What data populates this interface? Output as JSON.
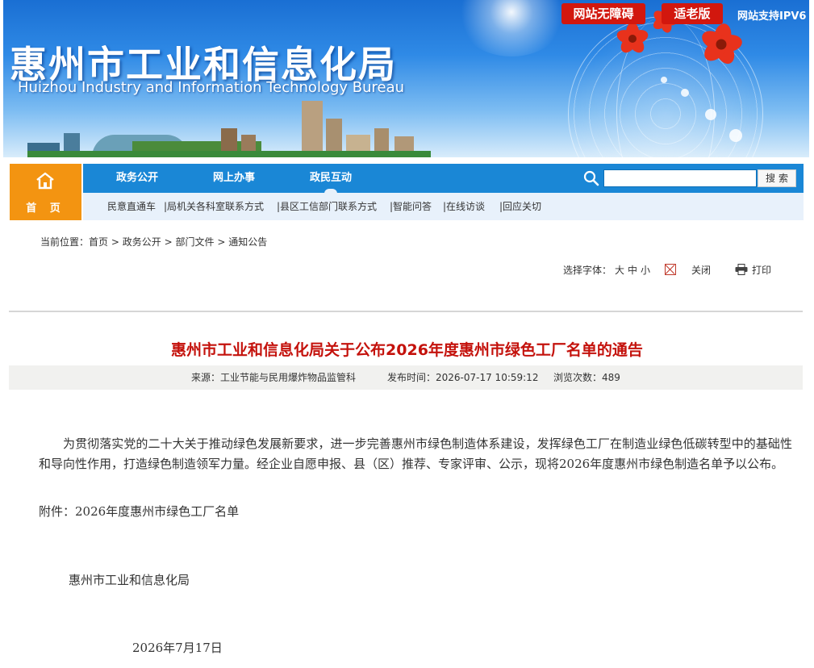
{
  "banner": {
    "title_cn": "惠州市工业和信息化局",
    "title_en": "Huizhou Industry and Information Technology Bureau",
    "accessibility_label": "网站无障碍",
    "elderly_label": "适老版",
    "ipv6_label": "网站支持IPV6"
  },
  "nav": {
    "home_label": "首 页",
    "items": [
      {
        "label": "政务公开"
      },
      {
        "label": "网上办事"
      },
      {
        "label": "政民互动",
        "active": true
      }
    ],
    "search": {
      "placeholder": "",
      "button_label": "搜索"
    },
    "sub_items": [
      {
        "label": "民意直通车"
      },
      {
        "label": "|局机关各科室联系方式"
      },
      {
        "label": "|县区工信部门联系方式"
      },
      {
        "label": "|智能问答"
      },
      {
        "label": "|在线访谈"
      },
      {
        "label": "|回应关切"
      }
    ]
  },
  "breadcrumb": {
    "prefix": "当前位置：",
    "items": [
      "首页",
      "政务公开",
      "部门文件",
      "通知公告"
    ],
    "separator": ">"
  },
  "tools": {
    "font_label": "选择字体：",
    "font_large": "大",
    "font_medium": "中",
    "font_small": "小",
    "close_label": "关闭",
    "print_label": "打印"
  },
  "article": {
    "title": "惠州市工业和信息化局关于公布2026年度惠州市绿色工厂名单的通告",
    "source_label": "来源：",
    "source": "工业节能与民用爆炸物品监管科",
    "publish_label": "发布时间：",
    "publish_time": "2026-07-17 10:59:12",
    "views_label": "浏览次数：",
    "views": "489",
    "body": "为贯彻落实党的二十大关于推动绿色发展新要求，进一步完善惠州市绿色制造体系建设，发挥绿色工厂在制造业绿色低碳转型中的基础性和导向性作用，打造绿色制造领军力量。经企业自愿申报、县（区）推荐、专家评审、公示，现将2026年度惠州市绿色制造名单予以公布。",
    "attachment": "附件：2026年度惠州市绿色工厂名单",
    "signature": "惠州市工业和信息化局",
    "date": "2026年7月17日"
  },
  "colors": {
    "nav_blue": "#1a87d6",
    "home_orange": "#f39411",
    "title_red": "#c4120c",
    "top_button_red": "#d2170e"
  }
}
